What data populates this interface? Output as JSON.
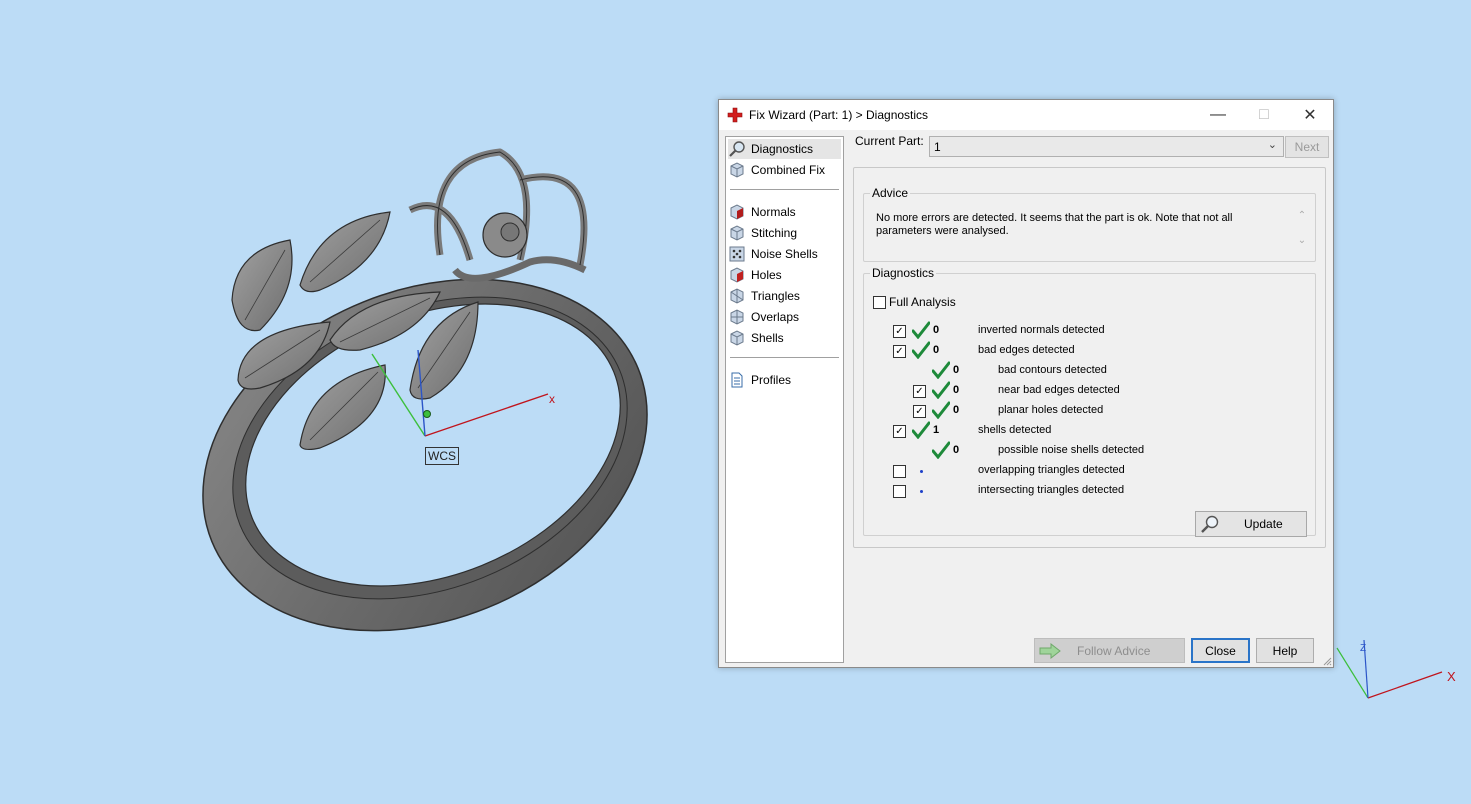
{
  "viewport": {
    "wcs_label": "WCS",
    "axis_x_label": "x",
    "corner_axis_x_label": "X",
    "corner_axis_z_label": "Z"
  },
  "dialog": {
    "title": "Fix Wizard (Part: 1) > Diagnostics",
    "nav": {
      "top_items": [
        {
          "label": "Diagnostics",
          "icon": "magnifier-icon"
        },
        {
          "label": "Combined Fix",
          "icon": "cube-icon"
        }
      ],
      "fix_items": [
        {
          "label": "Normals",
          "icon": "normals-cube-icon"
        },
        {
          "label": "Stitching",
          "icon": "stitching-cube-icon"
        },
        {
          "label": "Noise Shells",
          "icon": "noise-shells-icon"
        },
        {
          "label": "Holes",
          "icon": "holes-cube-icon"
        },
        {
          "label": "Triangles",
          "icon": "triangles-cube-icon"
        },
        {
          "label": "Overlaps",
          "icon": "overlaps-cube-icon"
        },
        {
          "label": "Shells",
          "icon": "shells-cube-icon"
        }
      ],
      "bottom_items": [
        {
          "label": "Profiles",
          "icon": "document-icon"
        }
      ]
    },
    "current_part_label": "Current Part:",
    "current_part_value": "1",
    "next_label": "Next",
    "advice": {
      "legend": "Advice",
      "text": "No more errors are detected. It seems that the part is ok. Note that not all parameters were analysed."
    },
    "diagnostics": {
      "legend": "Diagnostics",
      "full_analysis_label": "Full Analysis",
      "rows": [
        {
          "label": "inverted normals detected",
          "count": "0"
        },
        {
          "label": "bad edges detected",
          "count": "0"
        },
        {
          "label": "bad contours detected",
          "count": "0"
        },
        {
          "label": "near bad edges detected",
          "count": "0"
        },
        {
          "label": "planar holes detected",
          "count": "0"
        },
        {
          "label": "shells detected",
          "count": "1"
        },
        {
          "label": "possible noise shells detected",
          "count": "0"
        },
        {
          "label": "overlapping triangles detected",
          "count": ""
        },
        {
          "label": "intersecting triangles detected",
          "count": ""
        }
      ],
      "update_label": "Update"
    },
    "buttons": {
      "follow_advice": "Follow Advice",
      "close": "Close",
      "help": "Help"
    }
  },
  "colors": {
    "background": "#bcdcf6",
    "check_green": "#1e8a3a",
    "axis_red": "#c0141c",
    "axis_green": "#3cbf3c",
    "axis_blue": "#2b55c8"
  }
}
